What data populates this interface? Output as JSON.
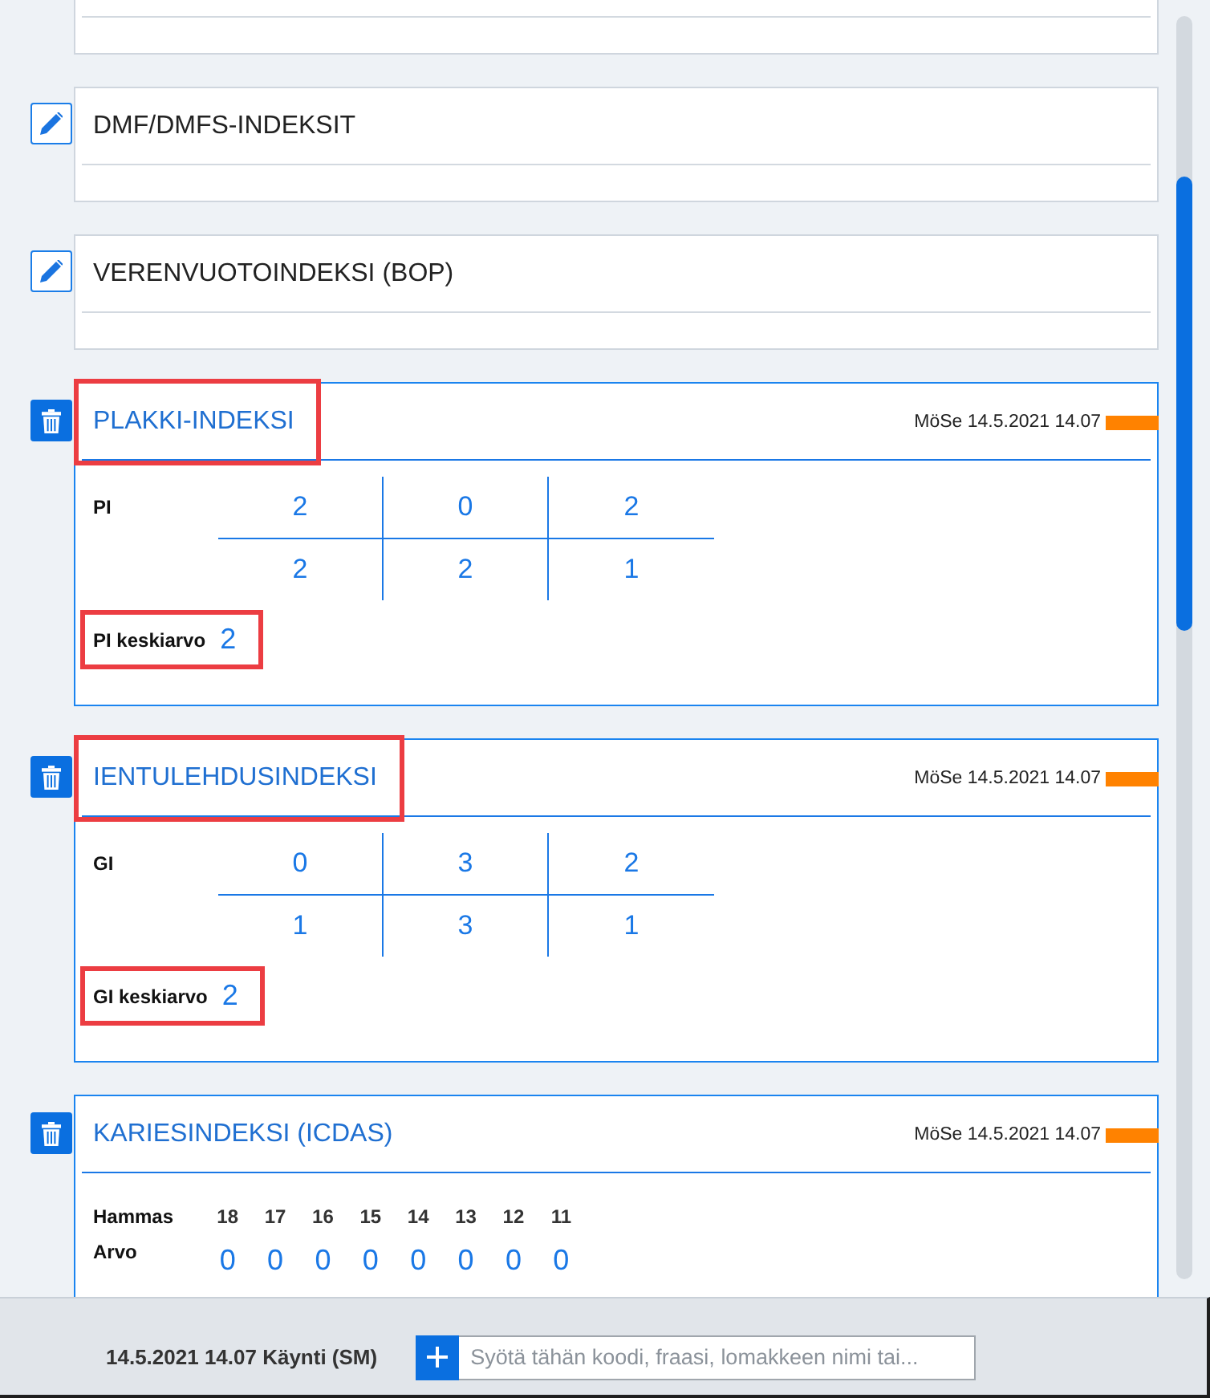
{
  "sections": [
    {
      "kind": "partial"
    },
    {
      "kind": "collapsed",
      "title": "DMF/DMFS-INDEKSIT"
    },
    {
      "kind": "collapsed",
      "title": "VERENVUOTOINDEKSI (BOP)"
    },
    {
      "kind": "grid",
      "title": "PLAKKI-INDEKSI",
      "title_highlighted": true,
      "timestamp": "MöSe 14.5.2021 14.07",
      "label": "PI",
      "rows": [
        [
          "2",
          "0",
          "2"
        ],
        [
          "2",
          "2",
          "1"
        ]
      ],
      "average": {
        "label": "PI keskiarvo",
        "value": "2",
        "highlighted": true
      }
    },
    {
      "kind": "grid",
      "title": "IENTULEHDUSINDEKSI",
      "title_highlighted": true,
      "timestamp": "MöSe 14.5.2021 14.07",
      "label": "GI",
      "rows": [
        [
          "0",
          "3",
          "2"
        ],
        [
          "1",
          "3",
          "1"
        ]
      ],
      "average": {
        "label": "GI keskiarvo",
        "value": "2",
        "highlighted": true
      }
    },
    {
      "kind": "teeth",
      "title": "KARIESINDEKSI (ICDAS)",
      "title_highlighted": false,
      "timestamp": "MöSe 14.5.2021 14.07",
      "row_labels": [
        "Hammas",
        "Arvo"
      ],
      "teeth": [
        {
          "number": "18",
          "value": "0"
        },
        {
          "number": "17",
          "value": "0"
        },
        {
          "number": "16",
          "value": "0"
        },
        {
          "number": "15",
          "value": "0"
        },
        {
          "number": "14",
          "value": "0"
        },
        {
          "number": "13",
          "value": "0"
        },
        {
          "number": "12",
          "value": "0"
        },
        {
          "number": "11",
          "value": "0"
        }
      ]
    }
  ],
  "footer": {
    "visit": "14.5.2021 14.07 Käynti (SM)",
    "search": {
      "placeholder": "Syötä tähän koodi, fraasi, lomakkeen nimi tai..."
    }
  }
}
